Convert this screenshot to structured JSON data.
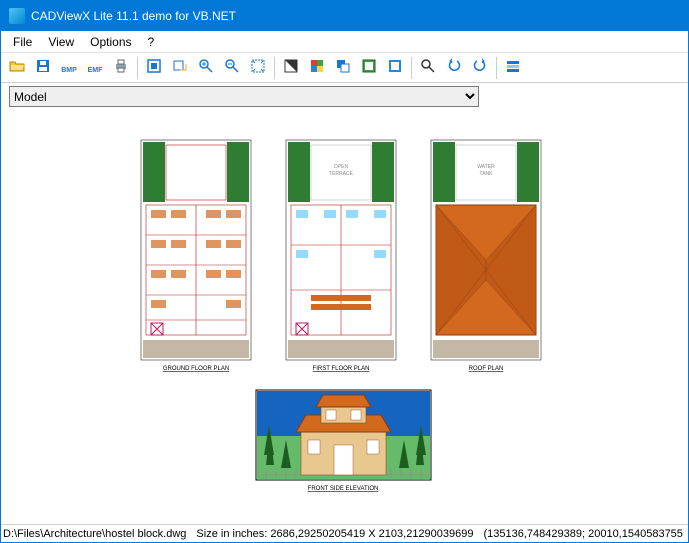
{
  "window": {
    "title": "CADViewX Lite 11.1 demo for VB.NET"
  },
  "menu": {
    "file": "File",
    "view": "View",
    "options": "Options",
    "help": "?"
  },
  "toolbar_icons": [
    {
      "name": "open-icon",
      "group": 0
    },
    {
      "name": "save-icon",
      "group": 0
    },
    {
      "name": "bmp-icon",
      "group": 0,
      "text": "BMP"
    },
    {
      "name": "emf-icon",
      "group": 0,
      "text": "EMF"
    },
    {
      "name": "print-icon",
      "group": 0
    },
    {
      "name": "fit-window-icon",
      "group": 1
    },
    {
      "name": "previous-view-icon",
      "group": 1
    },
    {
      "name": "zoom-in-icon",
      "group": 1
    },
    {
      "name": "zoom-out-icon",
      "group": 1
    },
    {
      "name": "extents-icon",
      "group": 1
    },
    {
      "name": "blackwhite-icon",
      "group": 2
    },
    {
      "name": "color-icon",
      "group": 2
    },
    {
      "name": "layers-icon",
      "group": 2
    },
    {
      "name": "viewport-icon",
      "group": 2
    },
    {
      "name": "entities-icon",
      "group": 2
    },
    {
      "name": "search-icon",
      "group": 3
    },
    {
      "name": "rotate-left-icon",
      "group": 3
    },
    {
      "name": "rotate-right-icon",
      "group": 3
    },
    {
      "name": "options-icon",
      "group": 4
    }
  ],
  "layout_select": {
    "value": "Model"
  },
  "labels": {
    "ground": "GROUND FLOOR PLAN",
    "first": "FIRST FLOOR PLAN",
    "roof": "ROOF PLAN",
    "elevation": "FRONT SIDE ELEVATION"
  },
  "drawing_text": {
    "open_terrace": "OPEN\nTERRACE",
    "water_tank": "WATER\nTANK"
  },
  "status": {
    "path": "D:\\Files\\Architecture\\hostel block.dwg",
    "size": "Size in inches: 2686,29250205419 X 2103,21290039699",
    "coords": "(135136,748429389; 20010,1540583755"
  },
  "colors": {
    "accent": "#0078d7",
    "brick": "#d2691e",
    "green": "#2e7d32"
  }
}
